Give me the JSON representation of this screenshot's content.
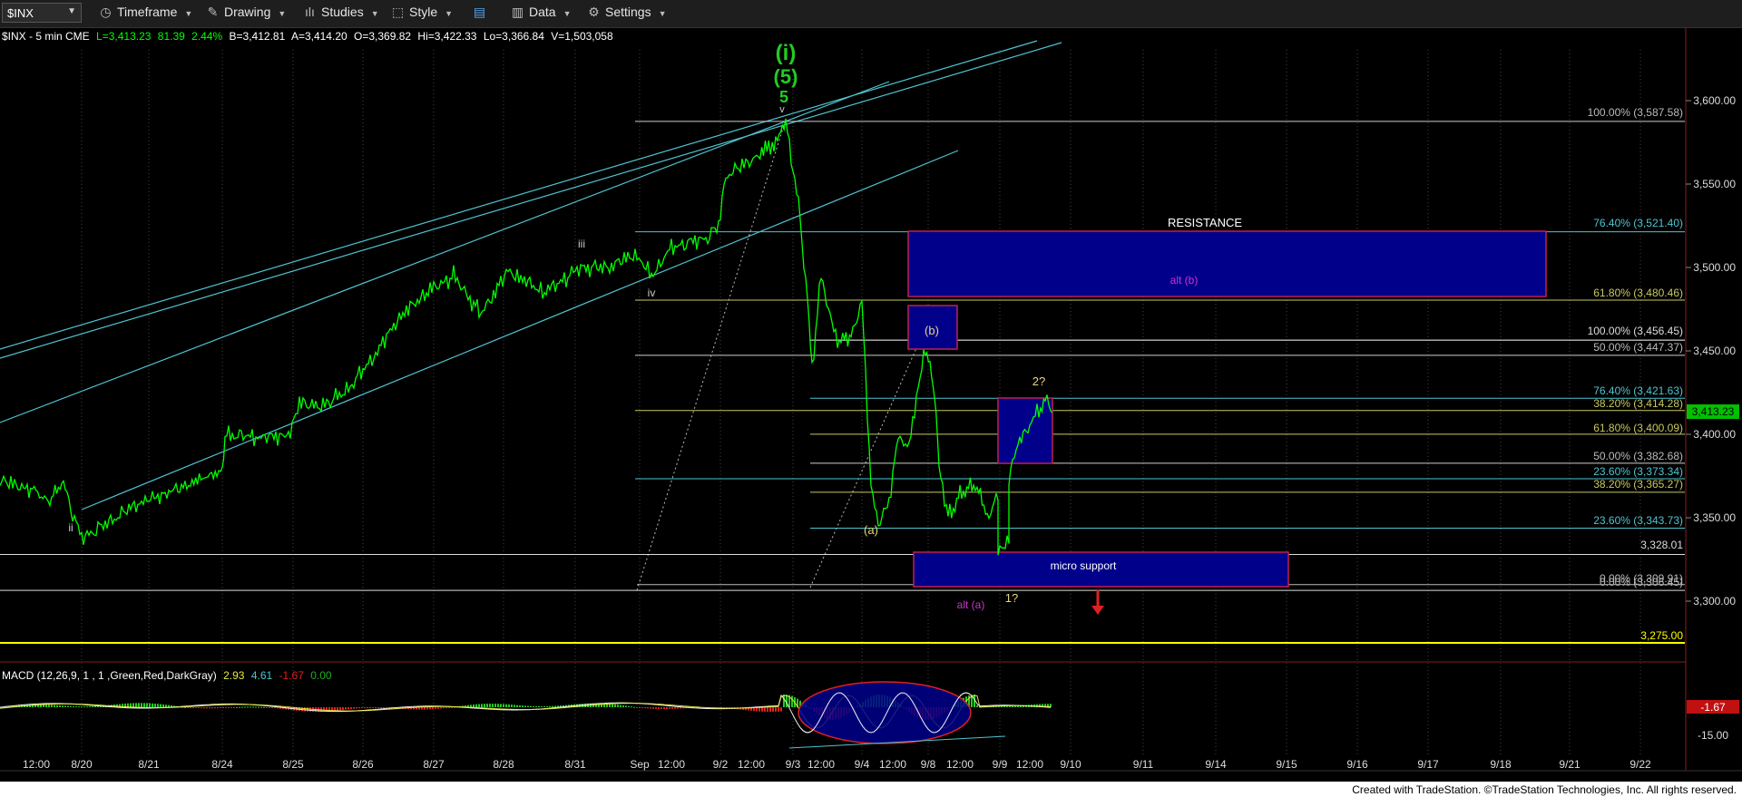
{
  "toolbar": {
    "symbol": "$INX",
    "timeframe_label": "Timeframe",
    "drawing_label": "Drawing",
    "studies_label": "Studies",
    "style_label": "Style",
    "data_label": "Data",
    "settings_label": "Settings"
  },
  "header": {
    "symbol_info": "$INX - 5 min  CME",
    "last": "L=3,413.23",
    "change": "81.39",
    "pct": "2.44%",
    "bid": "B=3,412.81",
    "ask": "A=3,414.20",
    "open": "O=3,369.82",
    "high": "Hi=3,422.33",
    "low": "Lo=3,366.84",
    "volume": "V=1,503,058"
  },
  "price_axis": {
    "ticks": [
      "3,600.00",
      "3,550.00",
      "3,500.00",
      "3,450.00",
      "3,400.00",
      "3,350.00",
      "3,300.00"
    ],
    "last_price": "3,413.23",
    "macd_last": "-1.67",
    "macd_tick": "-15.00"
  },
  "time_axis": {
    "labels": [
      "12:00",
      "8/20",
      "8/21",
      "8/24",
      "8/25",
      "8/26",
      "8/27",
      "8/28",
      "8/31",
      "Sep",
      "12:00",
      "9/2",
      "12:00",
      "9/3",
      "12:00",
      "9/4",
      "12:00",
      "9/8",
      "12:00",
      "9/9",
      "12:00",
      "9/10",
      "9/11",
      "9/14",
      "9/15",
      "9/16",
      "9/17",
      "9/18",
      "9/21",
      "9/22"
    ]
  },
  "fib_labels": {
    "f1": "100.00% (3,587.58)",
    "f2": "76.40% (3,521.40)",
    "f3": "61.80% (3,480.46)",
    "f4": "100.00% (3,456.45)",
    "f5": "50.00% (3,447.37)",
    "f6": "76.40% (3,421.63)",
    "f7": "38.20% (3,414.28)",
    "f8": "61.80% (3,400.09)",
    "f9": "50.00% (3,382.68)",
    "f10": "23.60% (3,373.34)",
    "f11": "38.20% (3,365.27)",
    "f12": "23.60% (3,343.73)",
    "f13": "3,328.01",
    "f14": "0.00% (3,309.91)",
    "f15": "0.00% (3,306.45)",
    "f16": "3,275.00"
  },
  "annotations": {
    "wave_i": "(i)",
    "wave_5p": "(5)",
    "wave_5": "5",
    "wave_v": "v",
    "wave_iii": "iii",
    "wave_iv": "iv",
    "wave_ii": "ii",
    "wave_a": "(a)",
    "wave_b": "(b)",
    "wave_2q": "2?",
    "wave_1q": "1?",
    "alt_a": "alt (a)",
    "alt_b": "alt (b)",
    "resistance": "RESISTANCE",
    "micro_support": "micro support"
  },
  "macd": {
    "label": "MACD (12,26,9, 1 , 1 ,Green,Red,DarkGray)",
    "v1": "2.93",
    "v2": "4.61",
    "v3": "-1.67",
    "v4": "0.00"
  },
  "colors": {
    "background": "#000000",
    "price_line": "#00ff00",
    "channel": "#4fc3d0",
    "box_fill": "#00008b",
    "box_border": "#c02050",
    "support_line": "#ffff00",
    "alt_label": "#cc33cc",
    "wave_label": "#e8d878"
  },
  "footer": {
    "credit": "Created with TradeStation. ©TradeStation Technologies, Inc. All rights reserved."
  },
  "chart_data": {
    "type": "line",
    "title": "$INX - 5 min",
    "x": [
      "8/20",
      "8/21",
      "8/24",
      "8/25",
      "8/26",
      "8/27",
      "8/28",
      "8/31",
      "9/1",
      "9/2",
      "9/3",
      "9/4",
      "9/8",
      "9/9"
    ],
    "series": [
      {
        "name": "$INX",
        "values": [
          3375,
          3385,
          3430,
          3441,
          3480,
          3490,
          3505,
          3500,
          3525,
          3575,
          3587,
          3360,
          3450,
          3413
        ]
      }
    ],
    "ylim": [
      3240,
      3630
    ],
    "fib_levels": [
      3587.58,
      3521.4,
      3480.46,
      3456.45,
      3447.37,
      3421.63,
      3414.28,
      3400.09,
      3382.68,
      3373.34,
      3365.27,
      3343.73,
      3328.01,
      3309.91,
      3306.45,
      3275.0
    ],
    "zones": [
      {
        "label": "RESISTANCE / alt (b)",
        "low": 3481,
        "high": 3522
      },
      {
        "label": "(b)",
        "low": 3452,
        "high": 3478
      },
      {
        "label": "2?",
        "low": 3382,
        "high": 3421
      },
      {
        "label": "micro support",
        "low": 3307,
        "high": 3329
      }
    ],
    "macd": {
      "macd": 2.93,
      "signal": 4.61,
      "histogram": -1.67,
      "zero": 0.0
    }
  }
}
